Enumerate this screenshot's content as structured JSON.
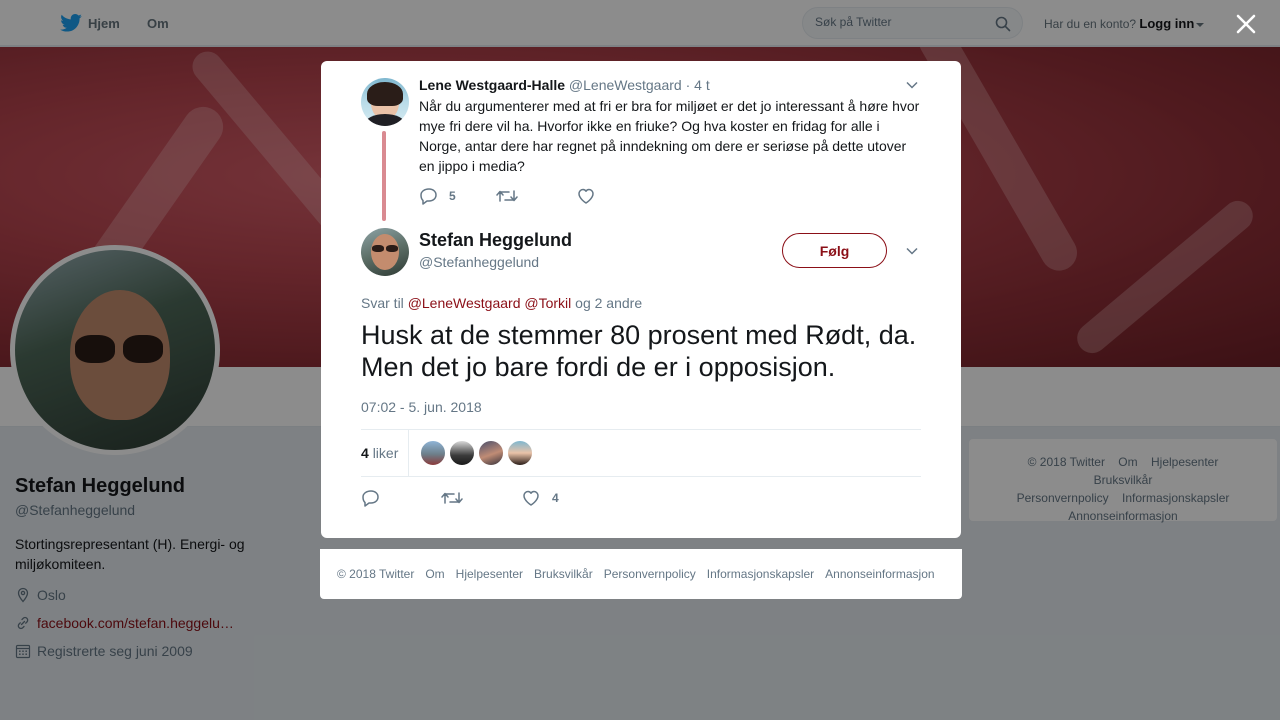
{
  "topbar": {
    "home_label": "Hjem",
    "about_label": "Om",
    "search_placeholder": "Søk på Twitter",
    "account_prompt": "Har du en konto?",
    "login_label": "Logg inn"
  },
  "profile": {
    "name": "Stefan Heggelund",
    "handle": "@Stefanheggelund",
    "bio": "Stortingsrepresentant (H). Energi- og miljøkomiteen.",
    "location": "Oslo",
    "website": "facebook.com/stefan.heggelu…",
    "joined": "Registrerte seg juni 2009"
  },
  "side_footer": {
    "copyright": "© 2018 Twitter",
    "links": [
      "Om",
      "Hjelpesenter",
      "Bruksvilkår",
      "Personvernpolicy",
      "Informasjonskapsler",
      "Annonseinformasjon"
    ]
  },
  "modal": {
    "parent_tweet": {
      "name": "Lene Westgaard-Halle",
      "handle": "@LeneWestgaard",
      "time": "· 4 t",
      "text": "Når du argumenterer med at fri er bra for miljøet er det jo interessant å høre hvor mye fri dere vil ha. Hvorfor ikke en friuke? Og hva koster en fridag for alle i Norge, antar dere har regnet på inndekning om dere er seriøse på dette utover en jippo i media?",
      "reply_count": "5"
    },
    "tweet": {
      "name": "Stefan Heggelund",
      "handle": "@Stefanheggelund",
      "follow_label": "Følg",
      "reply_prefix": "Svar til",
      "mention_1": "@LeneWestgaard",
      "mention_2": "@Torkil",
      "reply_suffix": "og 2 andre",
      "text": "Husk at de stemmer 80 prosent med Rødt, da. Men det jo bare fordi de er i opposisjon.",
      "timestamp": "07:02 - 5. jun. 2018",
      "like_count": "4",
      "likes_label": "liker",
      "like_action_count": "4"
    },
    "footer": {
      "copyright": "© 2018 Twitter",
      "links": [
        "Om",
        "Hjelpesenter",
        "Bruksvilkår",
        "Personvernpolicy",
        "Informasjonskapsler",
        "Annonseinformasjon"
      ]
    }
  },
  "colors": {
    "accent": "#8b0f17",
    "banner": "#b8454f",
    "thread_line": "#d98a91"
  },
  "icons": [
    "twitter-bird-icon",
    "search-icon",
    "close-icon",
    "chevron-down-icon",
    "reply-icon",
    "retweet-icon",
    "heart-icon",
    "location-icon",
    "link-icon",
    "calendar-icon"
  ]
}
